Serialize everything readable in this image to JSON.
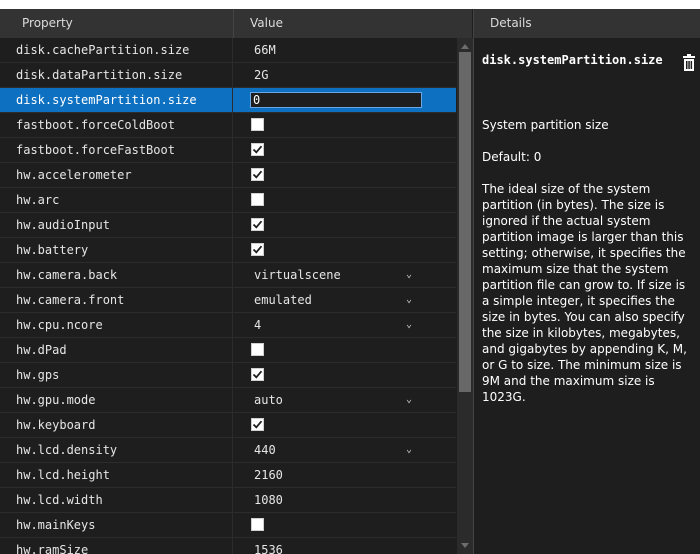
{
  "header": {
    "property_label": "Property",
    "value_label": "Value",
    "details_label": "Details"
  },
  "rows": [
    {
      "name": "disk.cachePartition.size",
      "type": "text",
      "value": "66M"
    },
    {
      "name": "disk.dataPartition.size",
      "type": "text",
      "value": "2G"
    },
    {
      "name": "disk.systemPartition.size",
      "type": "edit",
      "value": "0",
      "selected": true
    },
    {
      "name": "fastboot.forceColdBoot",
      "type": "checkbox",
      "checked": false
    },
    {
      "name": "fastboot.forceFastBoot",
      "type": "checkbox",
      "checked": true
    },
    {
      "name": "hw.accelerometer",
      "type": "checkbox",
      "checked": true
    },
    {
      "name": "hw.arc",
      "type": "checkbox",
      "checked": false
    },
    {
      "name": "hw.audioInput",
      "type": "checkbox",
      "checked": true
    },
    {
      "name": "hw.battery",
      "type": "checkbox",
      "checked": true
    },
    {
      "name": "hw.camera.back",
      "type": "dropdown",
      "value": "virtualscene"
    },
    {
      "name": "hw.camera.front",
      "type": "dropdown",
      "value": "emulated"
    },
    {
      "name": "hw.cpu.ncore",
      "type": "dropdown",
      "value": "4"
    },
    {
      "name": "hw.dPad",
      "type": "checkbox",
      "checked": false
    },
    {
      "name": "hw.gps",
      "type": "checkbox",
      "checked": true
    },
    {
      "name": "hw.gpu.mode",
      "type": "dropdown",
      "value": "auto"
    },
    {
      "name": "hw.keyboard",
      "type": "checkbox",
      "checked": true
    },
    {
      "name": "hw.lcd.density",
      "type": "dropdown",
      "value": "440"
    },
    {
      "name": "hw.lcd.height",
      "type": "text",
      "value": "2160"
    },
    {
      "name": "hw.lcd.width",
      "type": "text",
      "value": "1080"
    },
    {
      "name": "hw.mainKeys",
      "type": "checkbox",
      "checked": false
    },
    {
      "name": "hw.ramSize",
      "type": "text",
      "value": "1536"
    }
  ],
  "details": {
    "title": "disk.systemPartition.size",
    "subtitle": "System partition size",
    "default_text": "Default: 0",
    "body": "The ideal size of the system partition (in bytes). The size is ignored if the actual system partition image is larger than this setting; otherwise, it specifies the maximum size that the system partition file can grow to. If size is a simple integer, it specifies the size in bytes. You can also specify the size in kilobytes, megabytes, and gigabytes by appending K, M, or G to size. The minimum size is 9M and the maximum size is 1023G.",
    "delete_icon": "trash-icon"
  },
  "colors": {
    "background": "#1e1e1e",
    "header": "#333333",
    "selection": "#0e70c0",
    "scroll_thumb": "#686868"
  }
}
